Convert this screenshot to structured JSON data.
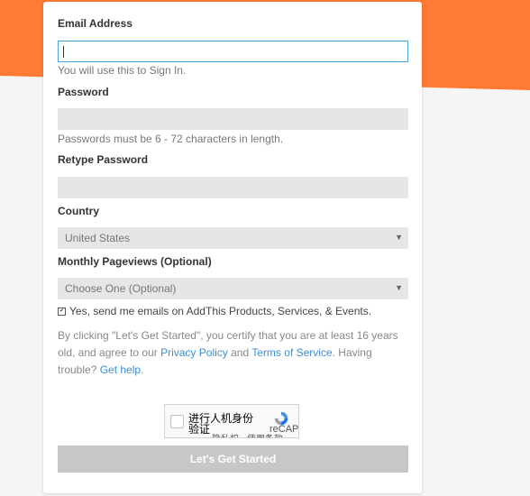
{
  "form": {
    "email_label": "Email Address",
    "email_value": "",
    "email_help": "You will use this to Sign In.",
    "password_label": "Password",
    "password_help": "Passwords must be 6 - 72 characters in length.",
    "retype_label": "Retype Password",
    "country_label": "Country",
    "country_value": "United States",
    "pageviews_label": "Monthly Pageviews (Optional)",
    "pageviews_value": "Choose One (Optional)",
    "newsletter_checked": true,
    "newsletter_label": "Yes, send me emails on AddThis Products, Services, & Events.",
    "legal_prefix": "By clicking \"Let's Get Started\", you certify that you are at least 16 years old, and agree to our ",
    "privacy_link": "Privacy Policy",
    "legal_and": " and ",
    "terms_link": "Terms of Service",
    "legal_trouble": ". Having trouble? ",
    "help_link": "Get help",
    "legal_end": ".",
    "submit_label": "Let's Get Started"
  },
  "captcha": {
    "text": "进行人机身份验证",
    "brand": "reCAPTCHA",
    "privacy": "隐私权 - 使用条款"
  },
  "icons": {
    "select_arrow": "dropdown-arrow-icon",
    "checkbox": "checkbox-icon",
    "recaptcha": "recaptcha-logo-icon"
  },
  "colors": {
    "accent_orange": "#ff7a35",
    "link_blue": "#3a8fd6",
    "focus_border": "#4aa3df",
    "button_disabled": "#c7c7c7"
  }
}
